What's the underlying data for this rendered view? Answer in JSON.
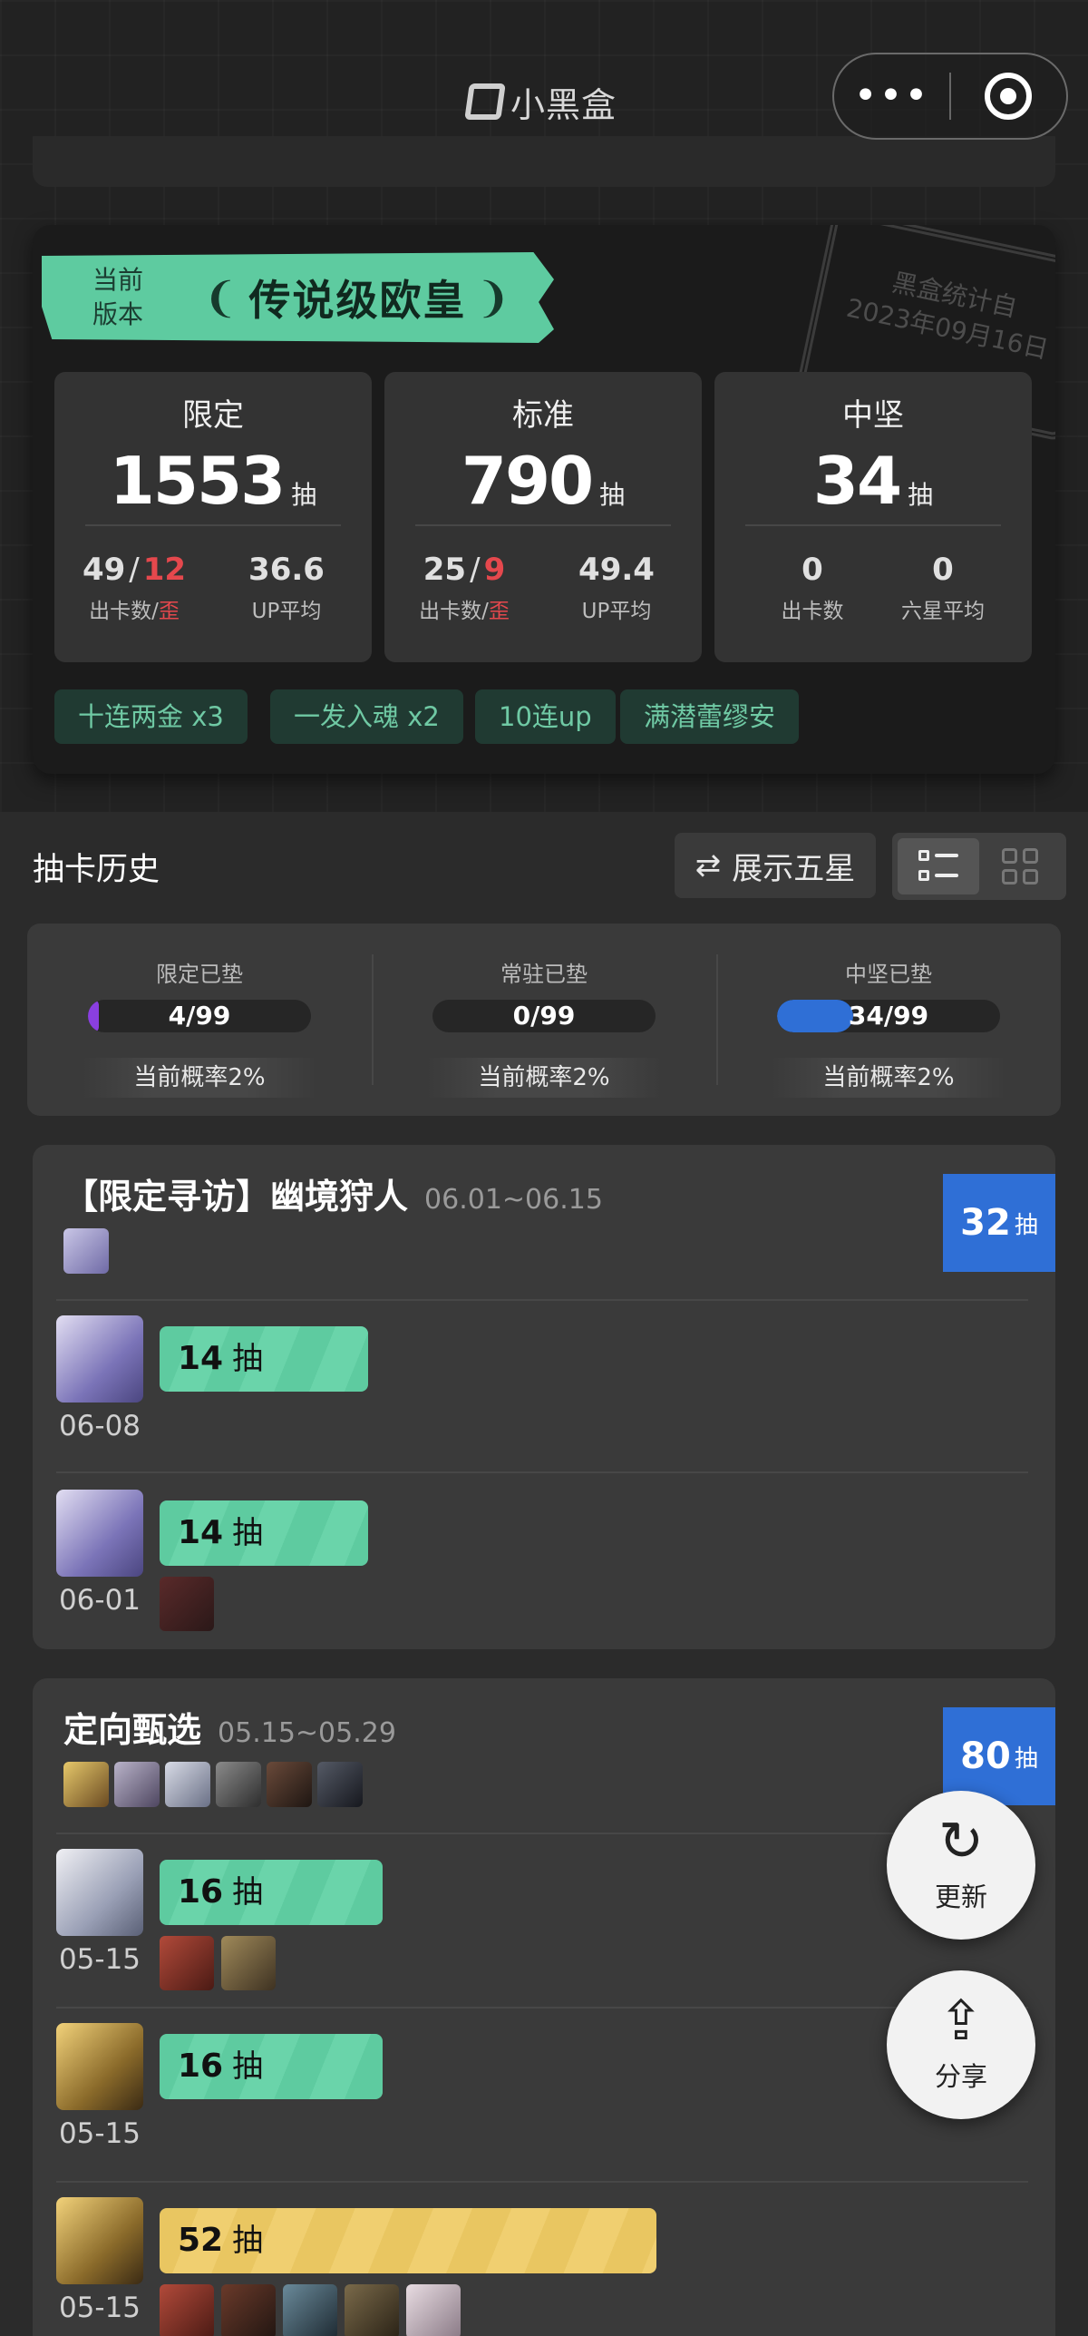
{
  "navbar": {
    "title": "小黑盒"
  },
  "summary": {
    "ribbon_label": "当前\n版本",
    "ribbon_title": "传说级欧皇",
    "stamp_line1": "黑盒统计自",
    "stamp_line2": "2023年09月16日",
    "stats": [
      {
        "name": "限定",
        "total": "1553",
        "unit": "抽",
        "left_cards": "49",
        "left_slash": "/",
        "left_off": "12",
        "left_label": "出卡数",
        "left_label_sep": "/",
        "left_label_off": "歪",
        "right_value": "36.6",
        "right_label": "UP平均"
      },
      {
        "name": "标准",
        "total": "790",
        "unit": "抽",
        "left_cards": "25",
        "left_slash": "/",
        "left_off": "9",
        "left_label": "出卡数",
        "left_label_sep": "/",
        "left_label_off": "歪",
        "right_value": "49.4",
        "right_label": "UP平均"
      },
      {
        "name": "中坚",
        "total": "34",
        "unit": "抽",
        "left_cards": "0",
        "left_label": "出卡数",
        "right_value": "0",
        "right_label": "六星平均"
      }
    ],
    "tags": [
      "十连两金  x3",
      "一发入魂 x2",
      "10连up",
      "满潜蕾缪安"
    ]
  },
  "history": {
    "title": "抽卡历史",
    "toggle_label": "展示五星",
    "pity": [
      {
        "label": "限定已垫",
        "value": "4/99",
        "fraction": 0.04,
        "color": "#8a3fe0",
        "rate": "当前概率2%"
      },
      {
        "label": "常驻已垫",
        "value": "0/99",
        "fraction": 0.0,
        "color": "#2f6fd6",
        "rate": "当前概率2%"
      },
      {
        "label": "中坚已垫",
        "value": "34/99",
        "fraction": 0.343,
        "color": "#2f6fd6",
        "rate": "当前概率2%"
      }
    ],
    "banners": [
      {
        "title": "【限定寻访】幽境狩人",
        "date": "06.01~06.15",
        "count": "32",
        "unit": "抽",
        "rows": [
          {
            "date": "06-08",
            "pulls": "14",
            "unit": "抽"
          },
          {
            "date": "06-01",
            "pulls": "14",
            "unit": "抽"
          }
        ]
      },
      {
        "title": "定向甄选",
        "date": "05.15~05.29",
        "count": "80",
        "unit": "抽",
        "rows": [
          {
            "date": "05-15",
            "pulls": "16",
            "unit": "抽"
          },
          {
            "date": "05-15",
            "pulls": "16",
            "unit": "抽"
          },
          {
            "date": "05-15",
            "pulls": "52",
            "unit": "抽"
          }
        ]
      }
    ]
  },
  "fab": {
    "refresh_label": "更新",
    "share_label": "分享"
  },
  "colors": {
    "accent_green": "#5ecba0",
    "badge_blue": "#2f6fd6",
    "gold": "#e9c661",
    "off_red": "#e5484d"
  }
}
